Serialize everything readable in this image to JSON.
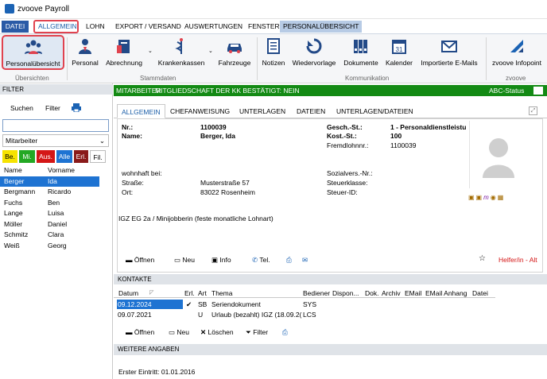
{
  "window": {
    "title": "zvoove Payroll"
  },
  "menu": {
    "items": [
      "DATEI",
      "ALLGEMEIN",
      "LOHN",
      "EXPORT / VERSAND",
      "AUSWERTUNGEN",
      "FENSTER",
      "PERSONALÜBERSICHT"
    ]
  },
  "ribbon": {
    "buttons": [
      "Personalübersicht",
      "Personal",
      "Abrechnung",
      "Krankenkassen",
      "Fahrzeuge",
      "Notizen",
      "Wiedervorlage",
      "Dokumente",
      "Kalender",
      "Importierte E-Mails",
      "zvoove Infopoint"
    ],
    "groups": [
      "Übersichten",
      "Stammdaten",
      "Kommunikation",
      "zvoove"
    ]
  },
  "filter": {
    "header": "FILTER",
    "search_label": "Suchen",
    "filter_label": "Filter",
    "search_value": "",
    "select_value": "Mitarbeiter",
    "chips": [
      "Be.",
      "Mi.",
      "Aus.",
      "Alle",
      "Erl.",
      "Fil."
    ],
    "columns": [
      "Name",
      "Vorname"
    ],
    "rows": [
      [
        "Berger",
        "Ida"
      ],
      [
        "Bergmann",
        "Ricardo"
      ],
      [
        "Fuchs",
        "Ben"
      ],
      [
        "Lange",
        "Luisa"
      ],
      [
        "Möller",
        "Daniel"
      ],
      [
        "Schmitz",
        "Clara"
      ],
      [
        "Weiß",
        "Georg"
      ]
    ]
  },
  "statusbar": {
    "left": "MITARBEITER",
    "middle": "MITGLIEDSCHAFT DER KK BESTÄTIGT: NEIN",
    "right": "ABC-Status"
  },
  "tabs": [
    "ALLGEMEIN",
    "CHEFANWEISUNG",
    "UNTERLAGEN",
    "DATEIEN",
    "UNTERLAGEN/DATEIEN"
  ],
  "employee": {
    "nr_label": "Nr.:",
    "nr": "1100039",
    "name_label": "Name:",
    "name": "Berger, Ida",
    "gesch_label": "Gesch.-St.:",
    "gesch": "1 - Personaldienstleistu",
    "kost_label": "Kost.-St.:",
    "kost": "100",
    "fremd_label": "Fremdlohnnr.:",
    "fremd": "1100039",
    "wohnhaft_label": "wohnhaft bei:",
    "strasse_label": "Straße:",
    "strasse": "Musterstraße 57",
    "ort_label": "Ort:",
    "ort": "83022 Rosenheim",
    "sv_label": "Sozialvers.-Nr.:",
    "steuerklasse_label": "Steuerklasse:",
    "steuerid_label": "Steuer-ID:",
    "tarif": "IGZ EG 2a / Minijobberin (feste monatliche Lohnart)"
  },
  "card_actions": [
    "Öffnen",
    "Neu",
    "Info",
    "Tel."
  ],
  "helper": "Helfer/in - Alt",
  "kontakte": {
    "header": "KONTAKTE",
    "columns": [
      "Datum",
      "Erl.",
      "Art",
      "Thema",
      "Bediener",
      "Dispon...",
      "Dok.",
      "Archiv",
      "EMail",
      "EMail Anhang",
      "Datei"
    ],
    "rows": [
      {
        "datum": "09.12.2024",
        "erl": "✔",
        "art": "SB",
        "thema": "Seriendokument",
        "bediener": "SYS"
      },
      {
        "datum": "09.07.2021",
        "erl": "",
        "art": "U",
        "thema": "Urlaub (bezahlt) IGZ (18.09.2(",
        "bediener": "LCS"
      }
    ],
    "actions": [
      "Öffnen",
      "Neu",
      "Löschen",
      "Filter"
    ]
  },
  "weitere": {
    "header": "WEITERE ANGABEN",
    "eintritt": "Erster Eintritt: 01.01.2016"
  },
  "colors": {
    "accent": "#1b63b4",
    "status_green": "#138a14",
    "highlight": "#e0434f"
  }
}
